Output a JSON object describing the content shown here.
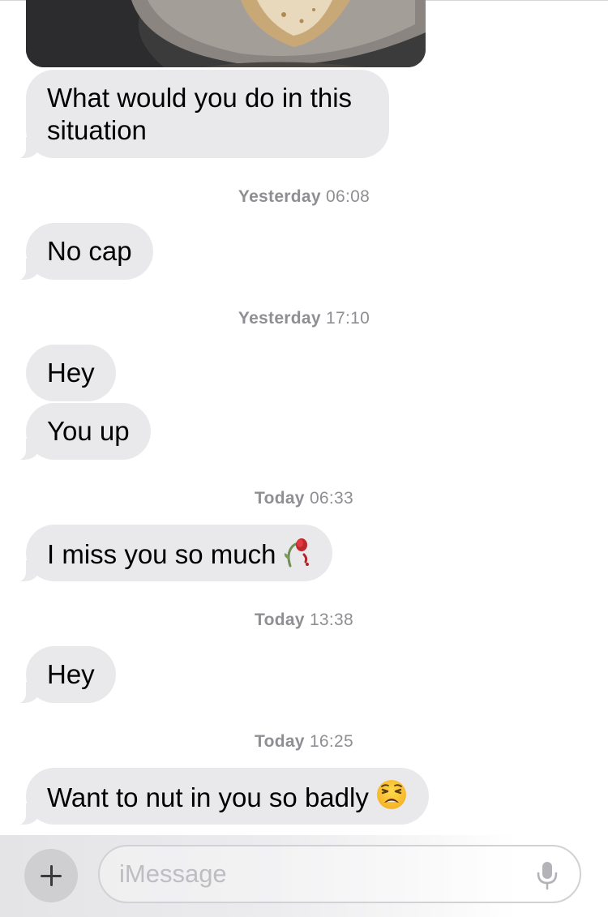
{
  "messages": [
    {
      "text": "What would you do in this situation"
    },
    {
      "text": "No cap"
    },
    {
      "text": "Hey"
    },
    {
      "text": "You up"
    },
    {
      "text": "I miss you so much",
      "emoji": "wilted-flower"
    },
    {
      "text": "Hey"
    },
    {
      "text": "Want to nut in you so badly",
      "emoji": "weary-face"
    }
  ],
  "timestamps": [
    {
      "day": "Yesterday",
      "time": "06:08"
    },
    {
      "day": "Yesterday",
      "time": "17:10"
    },
    {
      "day": "Today",
      "time": "06:33"
    },
    {
      "day": "Today",
      "time": "13:38"
    },
    {
      "day": "Today",
      "time": "16:25"
    }
  ],
  "composer": {
    "placeholder": "iMessage",
    "plus_icon": "plus-icon",
    "mic_icon": "microphone-icon"
  },
  "colors": {
    "incoming_bubble": "#e9e9eb",
    "timestamp": "#8e8e93"
  }
}
